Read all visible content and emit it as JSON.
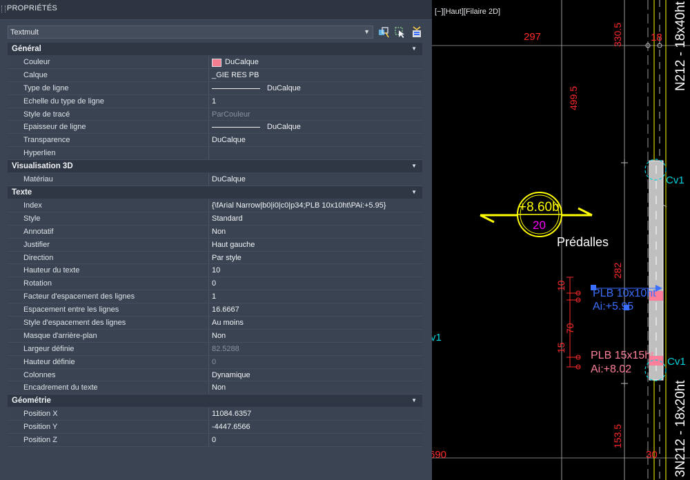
{
  "palette": {
    "title": "PROPRIÉTÉS",
    "selection": "Textmult"
  },
  "colors": {
    "swatch": "#f47d8f",
    "panel_bg": "#3b4453",
    "red_dims": "#ff2a2a",
    "yellow": "#ffff00",
    "cyan": "#00d5e0",
    "blue": "#3a6fff",
    "pink": "#ff7f9b",
    "magenta": "#ff00ff"
  },
  "icons": [
    "quick-select-icon",
    "select-objects-icon",
    "toggle-pickadd-icon"
  ],
  "sections": [
    {
      "title": "Général",
      "rows": [
        {
          "label": "Couleur",
          "value": "DuCalque",
          "type": "swatch"
        },
        {
          "label": "Calque",
          "value": "_GIE RES PB"
        },
        {
          "label": "Type de ligne",
          "value": "DuCalque",
          "type": "line"
        },
        {
          "label": "Echelle du type de ligne",
          "value": "1"
        },
        {
          "label": "Style de tracé",
          "value": "ParCouleur",
          "dim": true
        },
        {
          "label": "Epaisseur de ligne",
          "value": "DuCalque",
          "type": "line"
        },
        {
          "label": "Transparence",
          "value": "DuCalque"
        },
        {
          "label": "Hyperlien",
          "value": ""
        }
      ]
    },
    {
      "title": "Visualisation 3D",
      "rows": [
        {
          "label": "Matériau",
          "value": "DuCalque"
        }
      ]
    },
    {
      "title": "Texte",
      "rows": [
        {
          "label": "Index",
          "value": "{\\fArial Narrow|b0|i0|c0|p34;PLB 10x10ht\\PAi:+5.95}"
        },
        {
          "label": "Style",
          "value": "Standard"
        },
        {
          "label": "Annotatif",
          "value": "Non"
        },
        {
          "label": "Justifier",
          "value": "Haut gauche"
        },
        {
          "label": "Direction",
          "value": "Par style"
        },
        {
          "label": "Hauteur du texte",
          "value": "10"
        },
        {
          "label": "Rotation",
          "value": "0"
        },
        {
          "label": "Facteur d'espacement des lignes",
          "value": "1"
        },
        {
          "label": "Espacement entre les lignes",
          "value": "16.6667"
        },
        {
          "label": "Style d'espacement des lignes",
          "value": "Au moins"
        },
        {
          "label": "Masque d'arrière-plan",
          "value": "Non"
        },
        {
          "label": "Largeur définie",
          "value": "82.5288",
          "dim": true
        },
        {
          "label": "Hauteur définie",
          "value": "0",
          "dim": true
        },
        {
          "label": "Colonnes",
          "value": "Dynamique"
        },
        {
          "label": "Encadrement du texte",
          "value": "Non"
        }
      ]
    },
    {
      "title": "Géométrie",
      "rows": [
        {
          "label": "Position X",
          "value": "11084.6357"
        },
        {
          "label": "Position Y",
          "value": "-4447.6566"
        },
        {
          "label": "Position Z",
          "value": "0"
        }
      ]
    }
  ],
  "viewport": {
    "label": "[−][Haut][Filaire 2D]",
    "dims": {
      "d297": "297",
      "d330": "330.5",
      "d18": "18",
      "d499": "499.5",
      "d282": "282",
      "d10": "10",
      "d70": "70",
      "d15": "15",
      "d153": "153.5",
      "d30": "30",
      "d690": "690"
    },
    "beams": {
      "top": "N212 - 18x40ht",
      "bottom": "3N212 - 18x20ht"
    },
    "level_top": "+8.60b",
    "level_bottom": "20",
    "predalles": "Prédalles",
    "plb1_l1": "PLB 10x10ht",
    "plb1_l2": "Ai:+5.95",
    "plb2_l1": "PLB 15x15ht",
    "plb2_l2": "Ai:+8.02",
    "cv_a": "Cv1",
    "cv_b": "Cv1",
    "cv_c": "v1"
  }
}
